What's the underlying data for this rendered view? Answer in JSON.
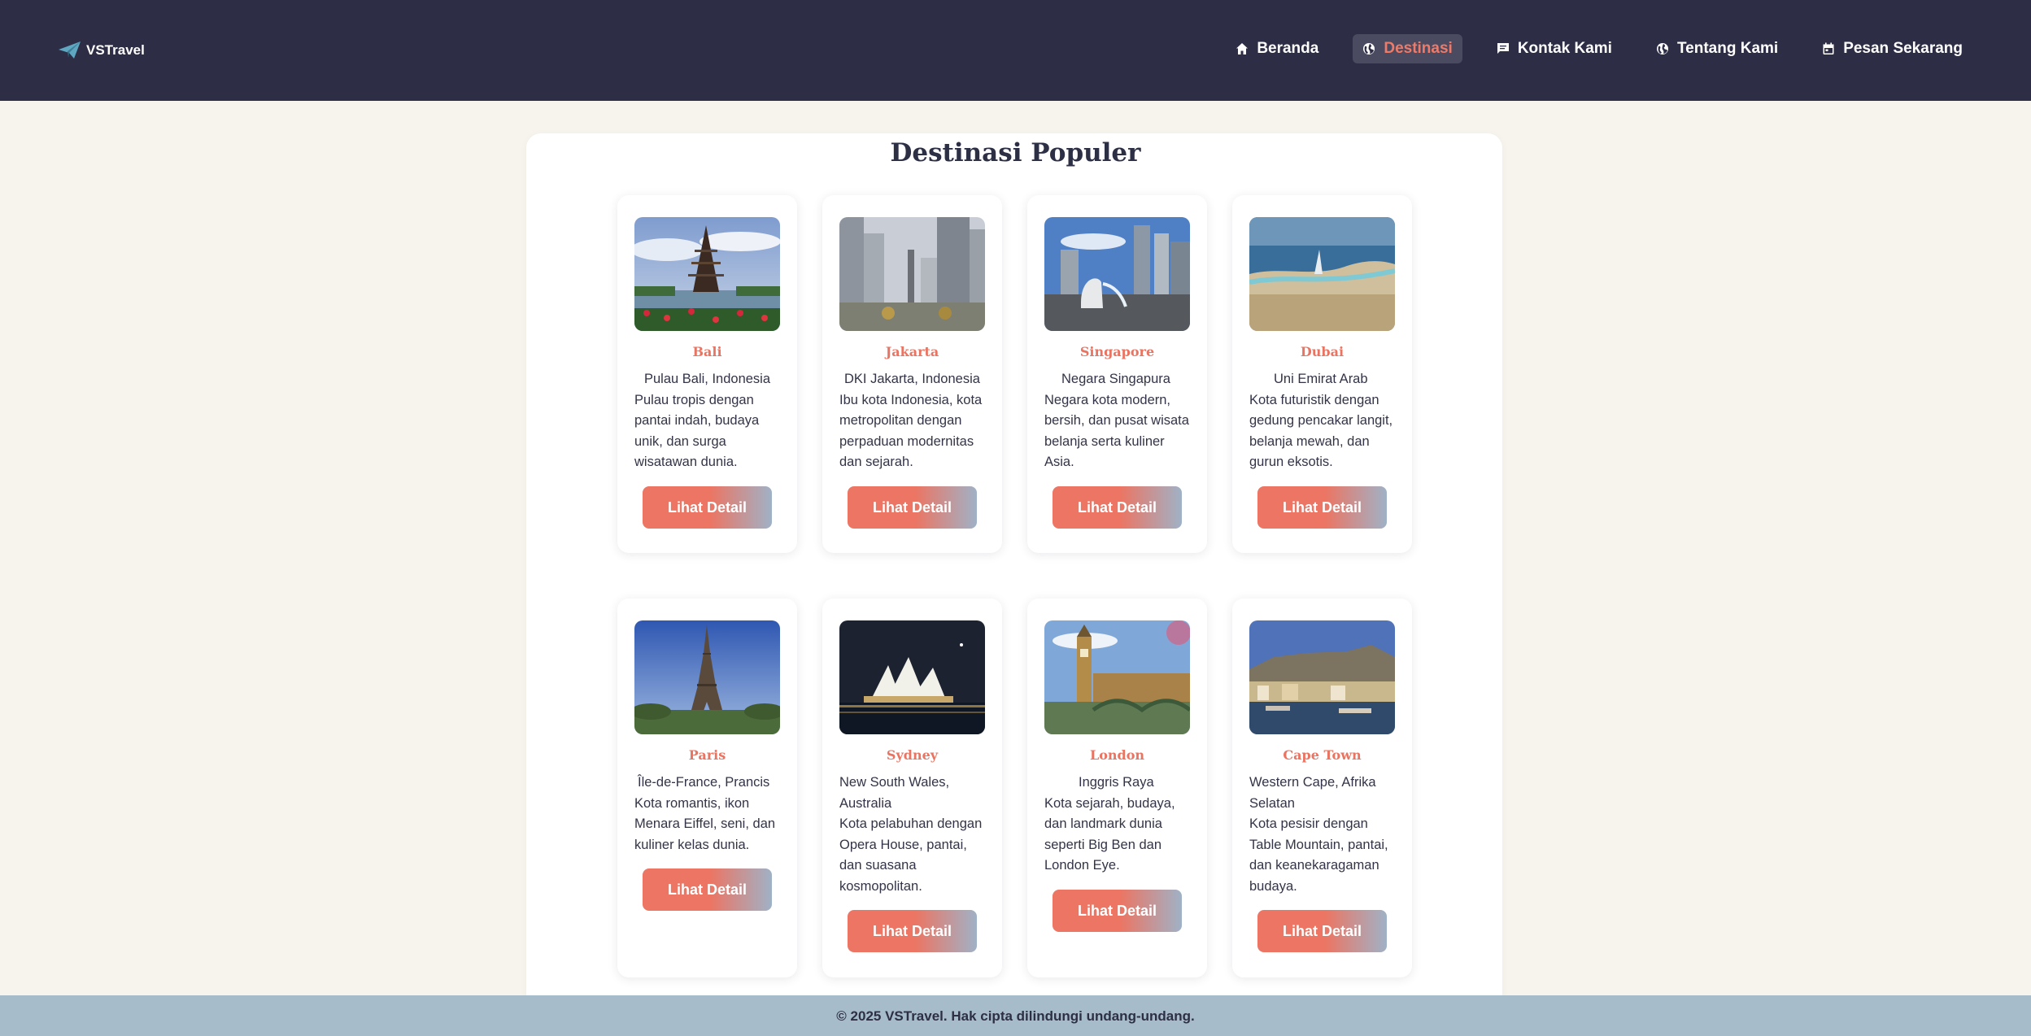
{
  "brand": {
    "name": "VSTravel"
  },
  "nav": [
    {
      "label": "Beranda",
      "icon": "home-icon"
    },
    {
      "label": "Destinasi",
      "icon": "globe-icon"
    },
    {
      "label": "Kontak Kami",
      "icon": "chat-icon"
    },
    {
      "label": "Tentang Kami",
      "icon": "globe-icon"
    },
    {
      "label": "Pesan Sekarang",
      "icon": "calendar-icon"
    }
  ],
  "page": {
    "title": "Destinasi Populer"
  },
  "destinations": [
    {
      "name": "Bali",
      "location": "Pulau Bali, Indonesia",
      "description": "Pulau tropis dengan pantai indah, budaya unik, dan surga wisatawan dunia.",
      "button": "Lihat Detail"
    },
    {
      "name": "Jakarta",
      "location": "DKI Jakarta, Indonesia",
      "description": "Ibu kota Indonesia, kota metropolitan dengan perpaduan modernitas dan sejarah.",
      "button": "Lihat Detail"
    },
    {
      "name": "Singapore",
      "location": "Negara Singapura",
      "description": "Negara kota modern, bersih, dan pusat wisata belanja serta kuliner Asia.",
      "button": "Lihat Detail"
    },
    {
      "name": "Dubai",
      "location": "Uni Emirat Arab",
      "description": "Kota futuristik dengan gedung pencakar langit, belanja mewah, dan gurun eksotis.",
      "button": "Lihat Detail"
    },
    {
      "name": "Paris",
      "location": "Île-de-France, Prancis",
      "description": "Kota romantis, ikon Menara Eiffel, seni, dan kuliner kelas dunia.",
      "button": "Lihat Detail"
    },
    {
      "name": "Sydney",
      "location": "New South Wales, Australia",
      "description": "Kota pelabuhan dengan Opera House, pantai, dan suasana kosmopolitan.",
      "button": "Lihat Detail"
    },
    {
      "name": "London",
      "location": "Inggris Raya",
      "description": "Kota sejarah, budaya, dan landmark dunia seperti Big Ben dan London Eye.",
      "button": "Lihat Detail"
    },
    {
      "name": "Cape Town",
      "location": "Western Cape, Afrika Selatan",
      "description": "Kota pesisir dengan Table Mountain, pantai, dan keanekaragaman budaya.",
      "button": "Lihat Detail"
    }
  ],
  "footer": {
    "text": "© 2025 VSTravel. Hak cipta dilindungi undang-undang."
  },
  "colors": {
    "header": "#2d2e46",
    "accent": "#ec7563",
    "footer": "#a7bccb",
    "background": "#f7f4ed"
  }
}
